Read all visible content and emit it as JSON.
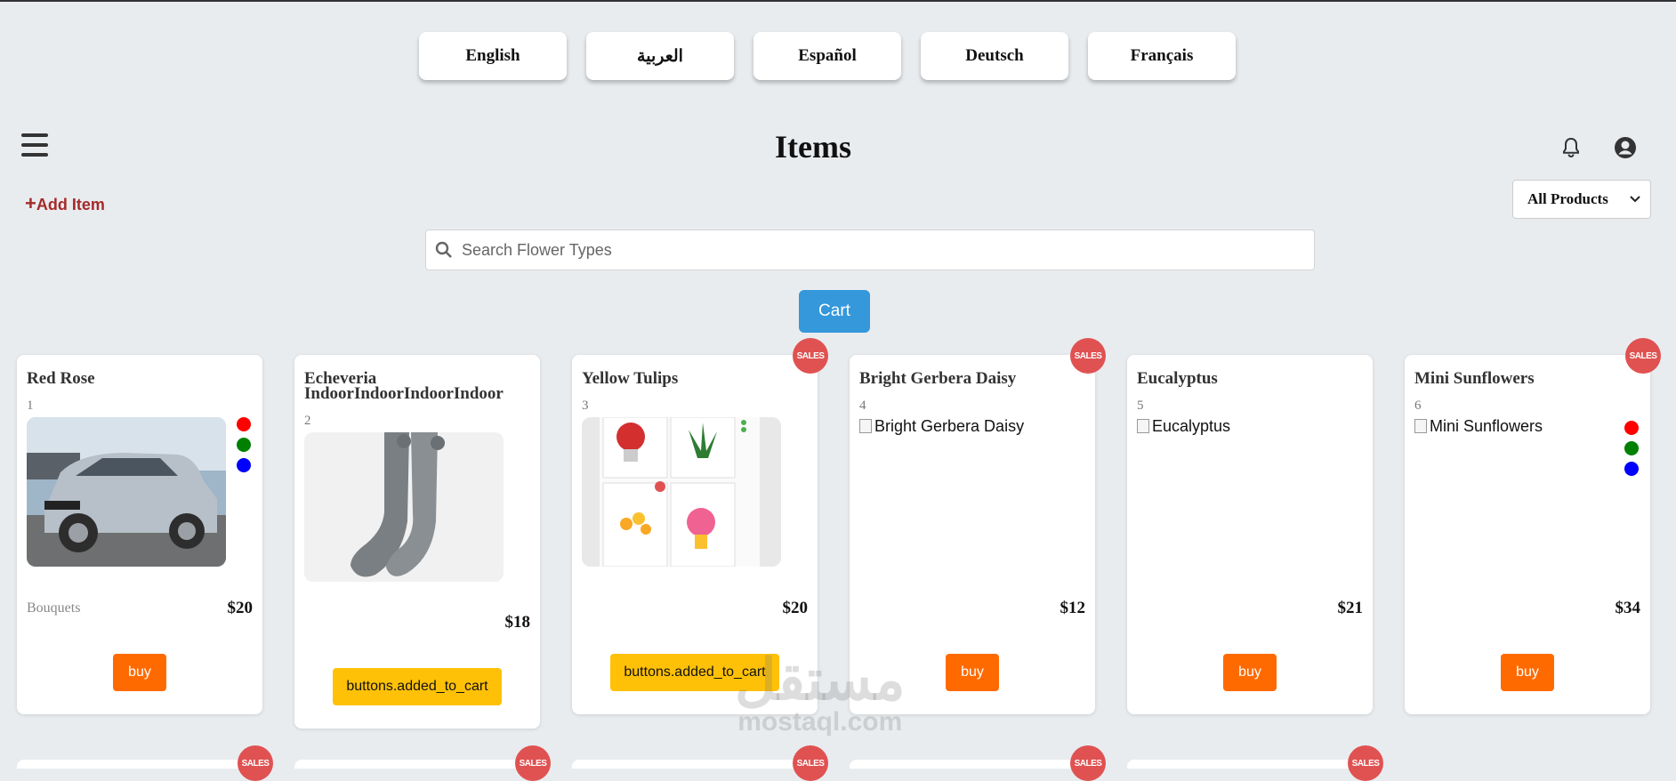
{
  "languages": [
    "English",
    "العربية",
    "Español",
    "Deutsch",
    "Français"
  ],
  "header": {
    "title": "Items",
    "menu_icon": "hamburger-icon",
    "notification_icon": "bell-icon",
    "account_icon": "user-circle-icon"
  },
  "toolbar": {
    "add_item_label": "Add Item",
    "filter_selected": "All Products",
    "search_placeholder": "Search Flower Types",
    "cart_label": "Cart"
  },
  "colors": {
    "accent_blue": "#3498db",
    "buy_orange": "#ff6a00",
    "added_yellow": "#ffc107",
    "sales_red": "#e05252",
    "add_item_red": "#a52a2a"
  },
  "cards": [
    {
      "name": "Red Rose",
      "id": "1",
      "image": "photo",
      "image_desc": "silver-suv-photo",
      "colors": [
        "#ff0000",
        "#008000",
        "#0000ff"
      ],
      "category": "Bouquets",
      "price": "$20",
      "button": "buy",
      "sale": false
    },
    {
      "name": "Echeveria IndoorIndoorIndoorIndoor",
      "id": "2",
      "image": "photo",
      "image_desc": "grey-knit-socks-photo",
      "colors": [],
      "category": "",
      "price": "$18",
      "button": "buttons.added_to_cart",
      "sale": false
    },
    {
      "name": "Yellow Tulips",
      "id": "3",
      "image": "photo",
      "image_desc": "flower-shop-screenshot",
      "colors": [],
      "category": "",
      "price": "$20",
      "button": "buttons.added_to_cart",
      "sale": true
    },
    {
      "name": "Bright Gerbera Daisy",
      "id": "4",
      "image": "broken",
      "alt": "Bright Gerbera Daisy",
      "colors": [],
      "category": "",
      "price": "$12",
      "button": "buy",
      "sale": true
    },
    {
      "name": "Eucalyptus",
      "id": "5",
      "image": "broken",
      "alt": "Eucalyptus",
      "colors": [],
      "category": "",
      "price": "$21",
      "button": "buy",
      "sale": false
    },
    {
      "name": "Mini Sunflowers",
      "id": "6",
      "image": "broken",
      "alt": "Mini Sunflowers",
      "colors": [
        "#ff0000",
        "#008000",
        "#0000ff"
      ],
      "category": "",
      "price": "$34",
      "button": "buy",
      "sale": true
    }
  ],
  "sales_badge_label": "SALES",
  "watermark": {
    "arabic": "مستقل",
    "latin": "mostaql.com"
  }
}
